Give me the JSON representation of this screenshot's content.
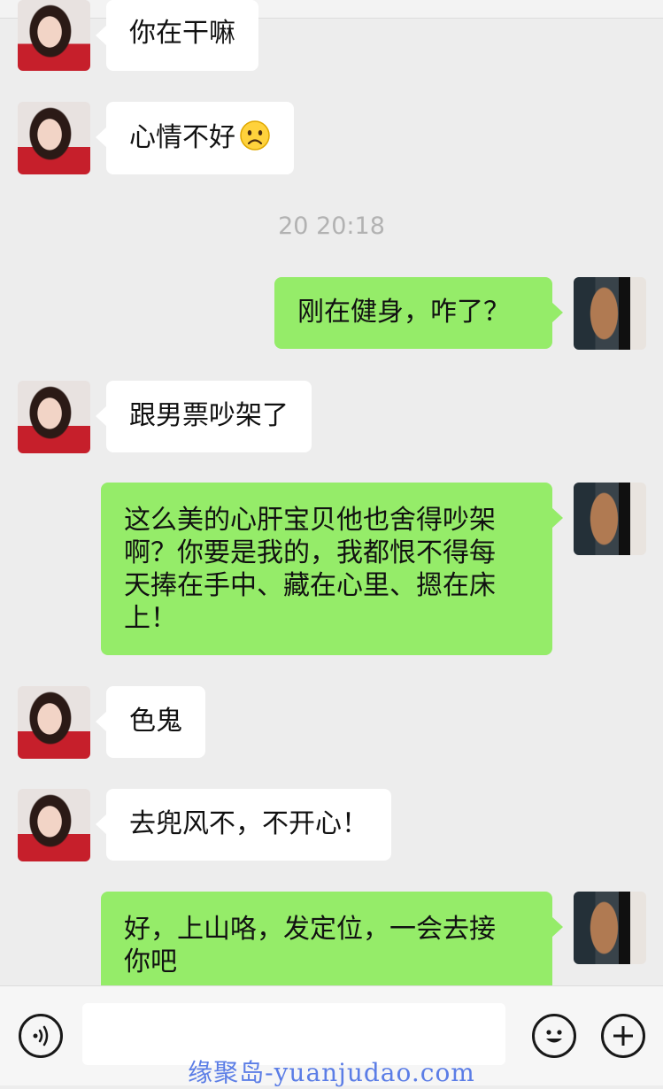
{
  "chat": {
    "timestamp": "20  20:18",
    "messages": [
      {
        "side": "left",
        "text": "你在干嘛"
      },
      {
        "side": "left",
        "text": "心情不好"
      },
      {
        "side": "right",
        "text": "刚在健身，咋了？"
      },
      {
        "side": "left",
        "text": "跟男票吵架了"
      },
      {
        "side": "right",
        "line1": "这么美的心肝宝贝他也舍得吵架",
        "line2": "啊？你要是我的，我都恨不得每",
        "line3": "天捧在手中、藏在心里、摁在床",
        "line4": "上！"
      },
      {
        "side": "left",
        "text": "色鬼"
      },
      {
        "side": "left",
        "text": "去兜风不，不开心！"
      },
      {
        "side": "right",
        "line1": "好，上山咯，发定位，一会去接",
        "line2": "你吧"
      }
    ]
  },
  "icons": {
    "voice": "voice-icon",
    "emoji": "emoji-icon",
    "plus": "plus-icon",
    "sad": "sad-face-emoji-icon"
  },
  "colors": {
    "background": "#ededed",
    "sent_bubble": "#95ec69",
    "received_bubble": "#ffffff",
    "watermark": "#5b7de6"
  },
  "watermark": "缘聚岛-yuanjudao.com"
}
